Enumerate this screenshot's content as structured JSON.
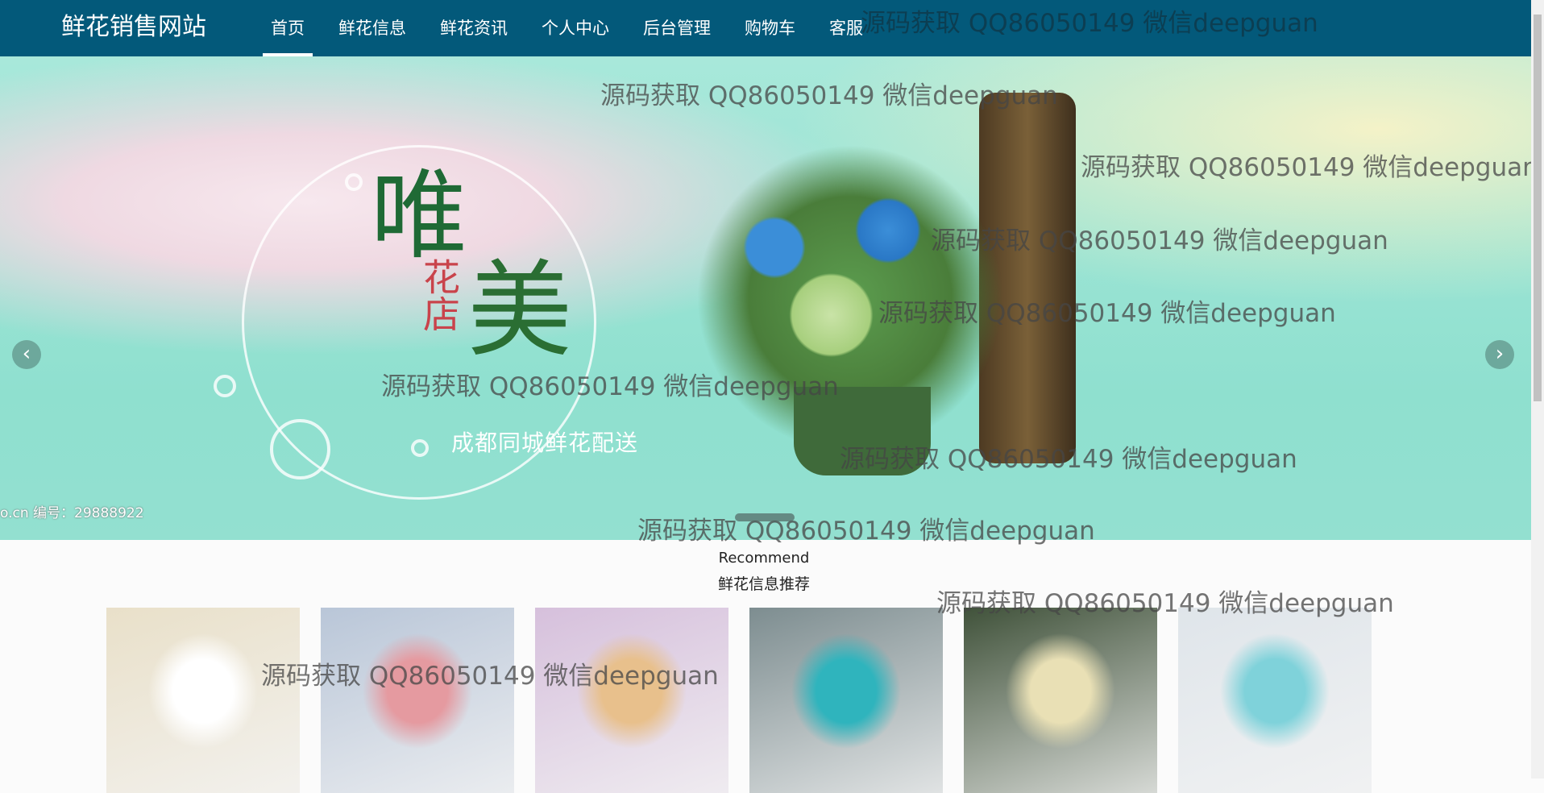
{
  "header": {
    "logo": "鲜花销售网站",
    "menu": [
      "首页",
      "鲜花信息",
      "鲜花资讯",
      "个人中心",
      "后台管理",
      "购物车",
      "客服"
    ],
    "active": "首页"
  },
  "banner": {
    "title_1": "唯",
    "title_2": "美",
    "title_small": "花店",
    "slogan": "成都同城鲜花配送",
    "code_text": "o.cn  编号：29888922",
    "prev_icon": "chevron-left",
    "next_icon": "chevron-right"
  },
  "recommend": {
    "title_en": "Recommend",
    "title_cn": "鲜花信息推荐",
    "cards": [
      {
        "color": "#e9e0c9",
        "accent": "#ffffff"
      },
      {
        "color": "#b9c6d8",
        "accent": "#e59aa0"
      },
      {
        "color": "#d6c0dc",
        "accent": "#e8c08c"
      },
      {
        "color": "#7d8d90",
        "accent": "#2fb4bd"
      },
      {
        "color": "#40523a",
        "accent": "#e9e0b5"
      },
      {
        "color": "#dfe5ea",
        "accent": "#7fd2da"
      }
    ]
  },
  "watermark": "源码获取 QQ86050149 微信deepguan",
  "colors": {
    "nav": "#03597a"
  }
}
